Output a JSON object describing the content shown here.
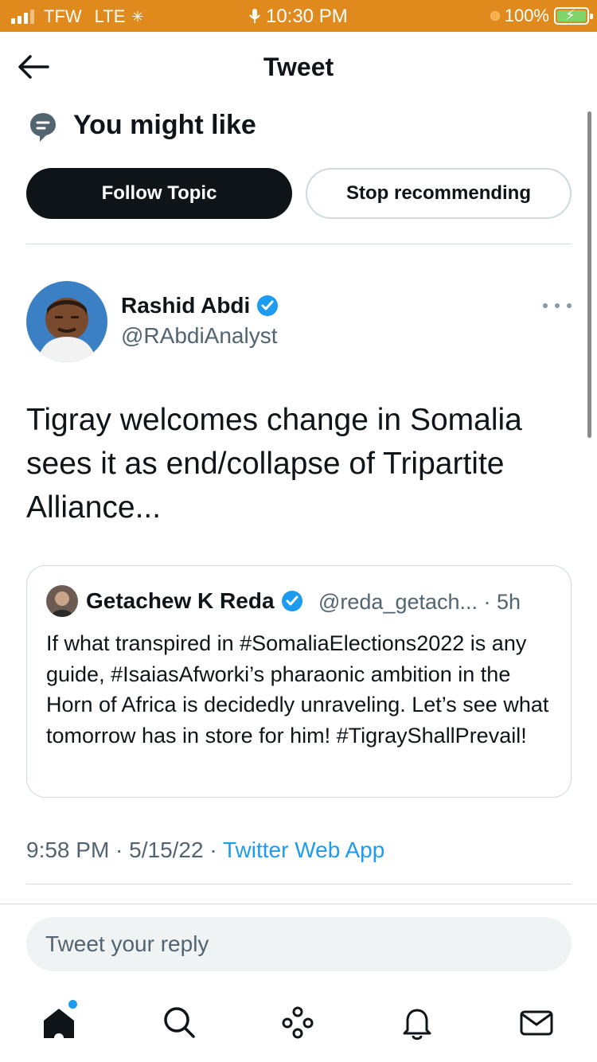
{
  "status_bar": {
    "carrier": "TFW",
    "network": "LTE",
    "time": "10:30 PM",
    "battery_percent": "100%",
    "bar_color": "#e08a1e"
  },
  "header": {
    "title": "Tweet"
  },
  "topic": {
    "title": "You might like",
    "follow_label": "Follow Topic",
    "stop_label": "Stop recommending"
  },
  "tweet": {
    "author_name": "Rashid Abdi",
    "author_handle": "@RAbdiAnalyst",
    "verified": true,
    "text": "Tigray welcomes change in Somalia sees it as end/collapse of Tripartite Alliance...",
    "timestamp": "9:58 PM · 5/15/22 · ",
    "source": "Twitter Web App"
  },
  "quoted_tweet": {
    "author_name": "Getachew K Reda",
    "verified": true,
    "meta": "@reda_getach... · 5h",
    "text": "If what transpired in #SomaliaElections2022 is any guide, #IsaiasAfworki’s pharaonic ambition in the Horn of Africa is decidedly unraveling. Let’s see what tomorrow has in store for him! #TigrayShallPrevail!"
  },
  "reply": {
    "placeholder": "Tweet your reply"
  },
  "tabbar": {
    "items": [
      "home-icon",
      "search-icon",
      "spaces-icon",
      "notifications-icon",
      "messages-icon"
    ],
    "accent": "#1d9bf0"
  }
}
